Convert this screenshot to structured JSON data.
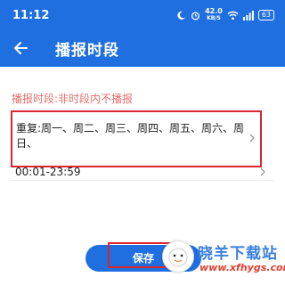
{
  "status_bar": {
    "time": "11:12",
    "net_speed_value": "42.0",
    "net_speed_unit": "KB/S",
    "battery": "63"
  },
  "header": {
    "title": "播报时段"
  },
  "notice": "播报时段:非时段内不播报",
  "repeat": {
    "text": "重复:周一、周二、周三、周四、周五、周六、周日、"
  },
  "time_range": {
    "text": "00:01-23:59"
  },
  "save_label": "保存",
  "watermark": {
    "title": "晓羊下载站",
    "url": "www.xfhygs.com"
  },
  "colors": {
    "primary": "#1f6fe0",
    "notice": "#e6706a",
    "highlight_border": "#d9272e"
  }
}
